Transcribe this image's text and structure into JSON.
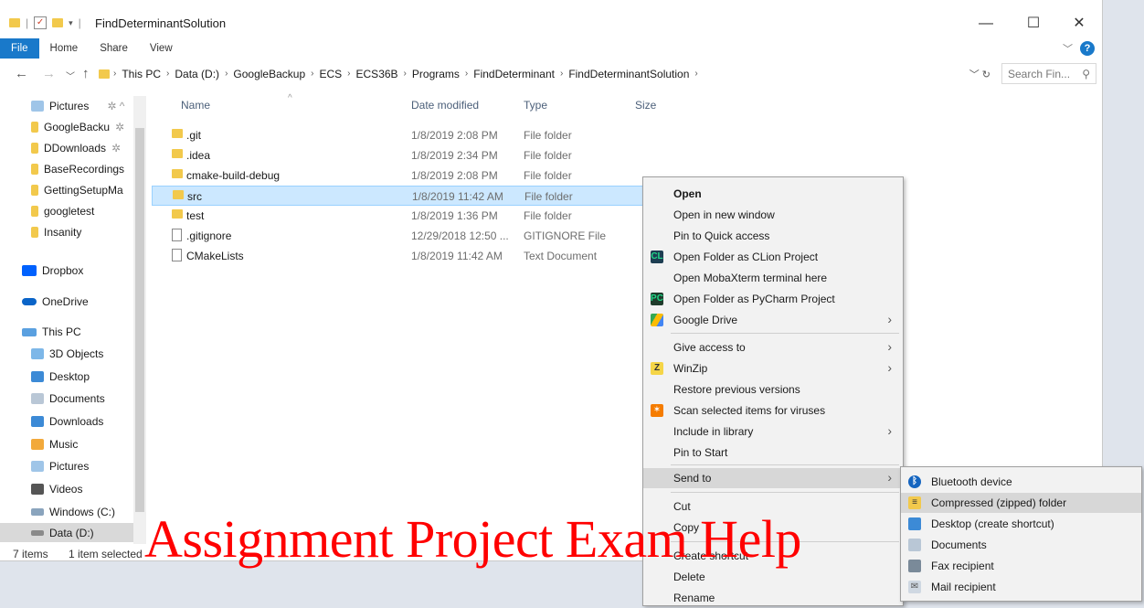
{
  "window": {
    "title": "FindDeterminantSolution"
  },
  "ribbon": {
    "tabs": [
      "File",
      "Home",
      "Share",
      "View"
    ]
  },
  "address": {
    "crumbs": [
      "This PC",
      "Data (D:)",
      "GoogleBackup",
      "ECS",
      "ECS36B",
      "Programs",
      "FindDeterminant",
      "FindDeterminantSolution"
    ],
    "search_placeholder": "Search Fin..."
  },
  "nav": {
    "quick": [
      {
        "label": "Pictures",
        "color": "#9fc5e8"
      },
      {
        "label": "GoogleBacku",
        "color": "#f2c94c"
      },
      {
        "label": "DDownloads",
        "color": "#f2c94c"
      },
      {
        "label": "BaseRecordings",
        "color": "#f2c94c"
      },
      {
        "label": "GettingSetupMa",
        "color": "#f2c94c"
      },
      {
        "label": "googletest",
        "color": "#f2c94c"
      },
      {
        "label": "Insanity",
        "color": "#f2c94c"
      }
    ],
    "dropbox": "Dropbox",
    "onedrive": "OneDrive",
    "thispc": "This PC",
    "pc_items": [
      {
        "label": "3D Objects",
        "color": "#7db7e8"
      },
      {
        "label": "Desktop",
        "color": "#3c8ad6"
      },
      {
        "label": "Documents",
        "color": "#b9c7d6"
      },
      {
        "label": "Downloads",
        "color": "#3c8ad6"
      },
      {
        "label": "Music",
        "color": "#f2a93b"
      },
      {
        "label": "Pictures",
        "color": "#9fc5e8"
      },
      {
        "label": "Videos",
        "color": "#555555"
      },
      {
        "label": "Windows (C:)",
        "color": "#8aa4bd"
      },
      {
        "label": "Data (D:)",
        "color": "#8a8a8a"
      }
    ]
  },
  "columns": {
    "name": "Name",
    "date": "Date modified",
    "type": "Type",
    "size": "Size"
  },
  "files": [
    {
      "name": ".git",
      "date": "1/8/2019 2:08 PM",
      "type": "File folder",
      "kind": "folder"
    },
    {
      "name": ".idea",
      "date": "1/8/2019 2:34 PM",
      "type": "File folder",
      "kind": "folder"
    },
    {
      "name": "cmake-build-debug",
      "date": "1/8/2019 2:08 PM",
      "type": "File folder",
      "kind": "folder"
    },
    {
      "name": "src",
      "date": "1/8/2019 11:42 AM",
      "type": "File folder",
      "kind": "folder"
    },
    {
      "name": "test",
      "date": "1/8/2019 1:36 PM",
      "type": "File folder",
      "kind": "folder"
    },
    {
      "name": ".gitignore",
      "date": "12/29/2018 12:50 ...",
      "type": "GITIGNORE File",
      "kind": "file"
    },
    {
      "name": "CMakeLists",
      "date": "1/8/2019 11:42 AM",
      "type": "Text Document",
      "kind": "file"
    }
  ],
  "status": {
    "items": "7 items",
    "selected": "1 item selected"
  },
  "context_menu": [
    {
      "label": "Open",
      "bold": true
    },
    {
      "label": "Open in new window"
    },
    {
      "label": "Pin to Quick access"
    },
    {
      "label": "Open Folder as CLion Project",
      "icon": "clion"
    },
    {
      "label": "Open MobaXterm terminal here"
    },
    {
      "label": "Open Folder as PyCharm Project",
      "icon": "pycharm"
    },
    {
      "label": "Google Drive",
      "icon": "gdrive",
      "submenu": true
    },
    {
      "label": "Give access to",
      "submenu": true
    },
    {
      "label": "WinZip",
      "icon": "winzip",
      "submenu": true
    },
    {
      "label": "Restore previous versions"
    },
    {
      "label": "Scan selected items for viruses",
      "icon": "avast"
    },
    {
      "label": "Include in library",
      "submenu": true
    },
    {
      "label": "Pin to Start"
    },
    {
      "label": "Send to",
      "submenu": true,
      "highlight": true
    },
    {
      "label": "Cut"
    },
    {
      "label": "Copy"
    },
    {
      "label": "Create shortcut"
    },
    {
      "label": "Delete"
    },
    {
      "label": "Rename"
    }
  ],
  "send_to": [
    {
      "label": "Bluetooth device"
    },
    {
      "label": "Compressed (zipped) folder",
      "highlight": true
    },
    {
      "label": "Desktop (create shortcut)"
    },
    {
      "label": "Documents"
    },
    {
      "label": "Fax recipient"
    },
    {
      "label": "Mail recipient"
    }
  ],
  "watermark": "Assignment Project Exam Help"
}
